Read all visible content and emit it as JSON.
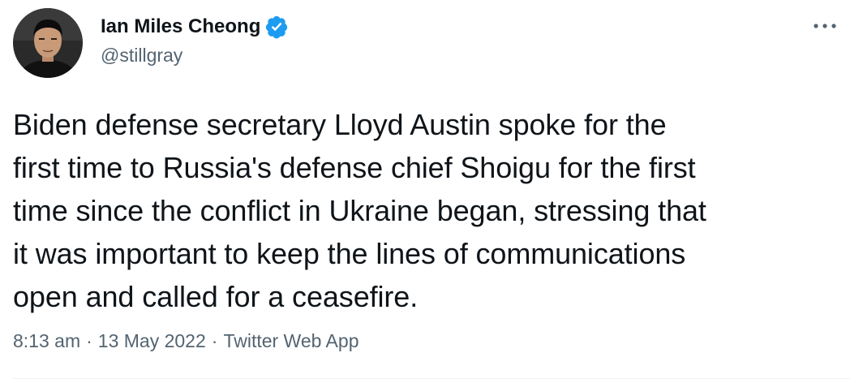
{
  "author": {
    "display_name": "Ian Miles Cheong",
    "handle": "@stillgray",
    "verified": true,
    "avatar_icon": "user-avatar"
  },
  "tweet": {
    "lines": [
      "Biden defense secretary Lloyd Austin spoke for the",
      "first time to Russia's defense chief Shoigu for the first",
      "time since the conflict in Ukraine began, stressing that",
      "it was important to keep the lines of communications",
      "open and called for a ceasefire."
    ]
  },
  "meta": {
    "time": "8:13 am",
    "separator": "·",
    "date": "13 May 2022",
    "source": "Twitter Web App"
  },
  "icons": {
    "verified": "verified-badge-icon",
    "more": "more-options-icon"
  },
  "colors": {
    "text_primary": "#0f1419",
    "text_secondary": "#536471",
    "verified_blue": "#1d9bf0",
    "divider": "#eff3f4"
  }
}
